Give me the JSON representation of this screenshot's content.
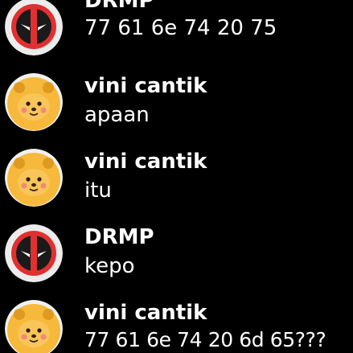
{
  "messages": [
    {
      "sender": "DRMP",
      "avatar": "deadpool-icon",
      "text": "77 61 6e 74 20 75"
    },
    {
      "sender": "vini cantik",
      "avatar": "bear-icon",
      "text": "apaan"
    },
    {
      "sender": "vini cantik",
      "avatar": "bear-icon",
      "text": "itu"
    },
    {
      "sender": "DRMP",
      "avatar": "deadpool-icon",
      "text": "kepo"
    },
    {
      "sender": "vini cantik",
      "avatar": "bear-icon",
      "text": "77 61 6e 74 20 6d 65???"
    }
  ],
  "colors": {
    "background": "#000000",
    "text": "#ffffff",
    "deadpool_red": "#d62a2a",
    "bear_yellow": "#f6b93b"
  }
}
